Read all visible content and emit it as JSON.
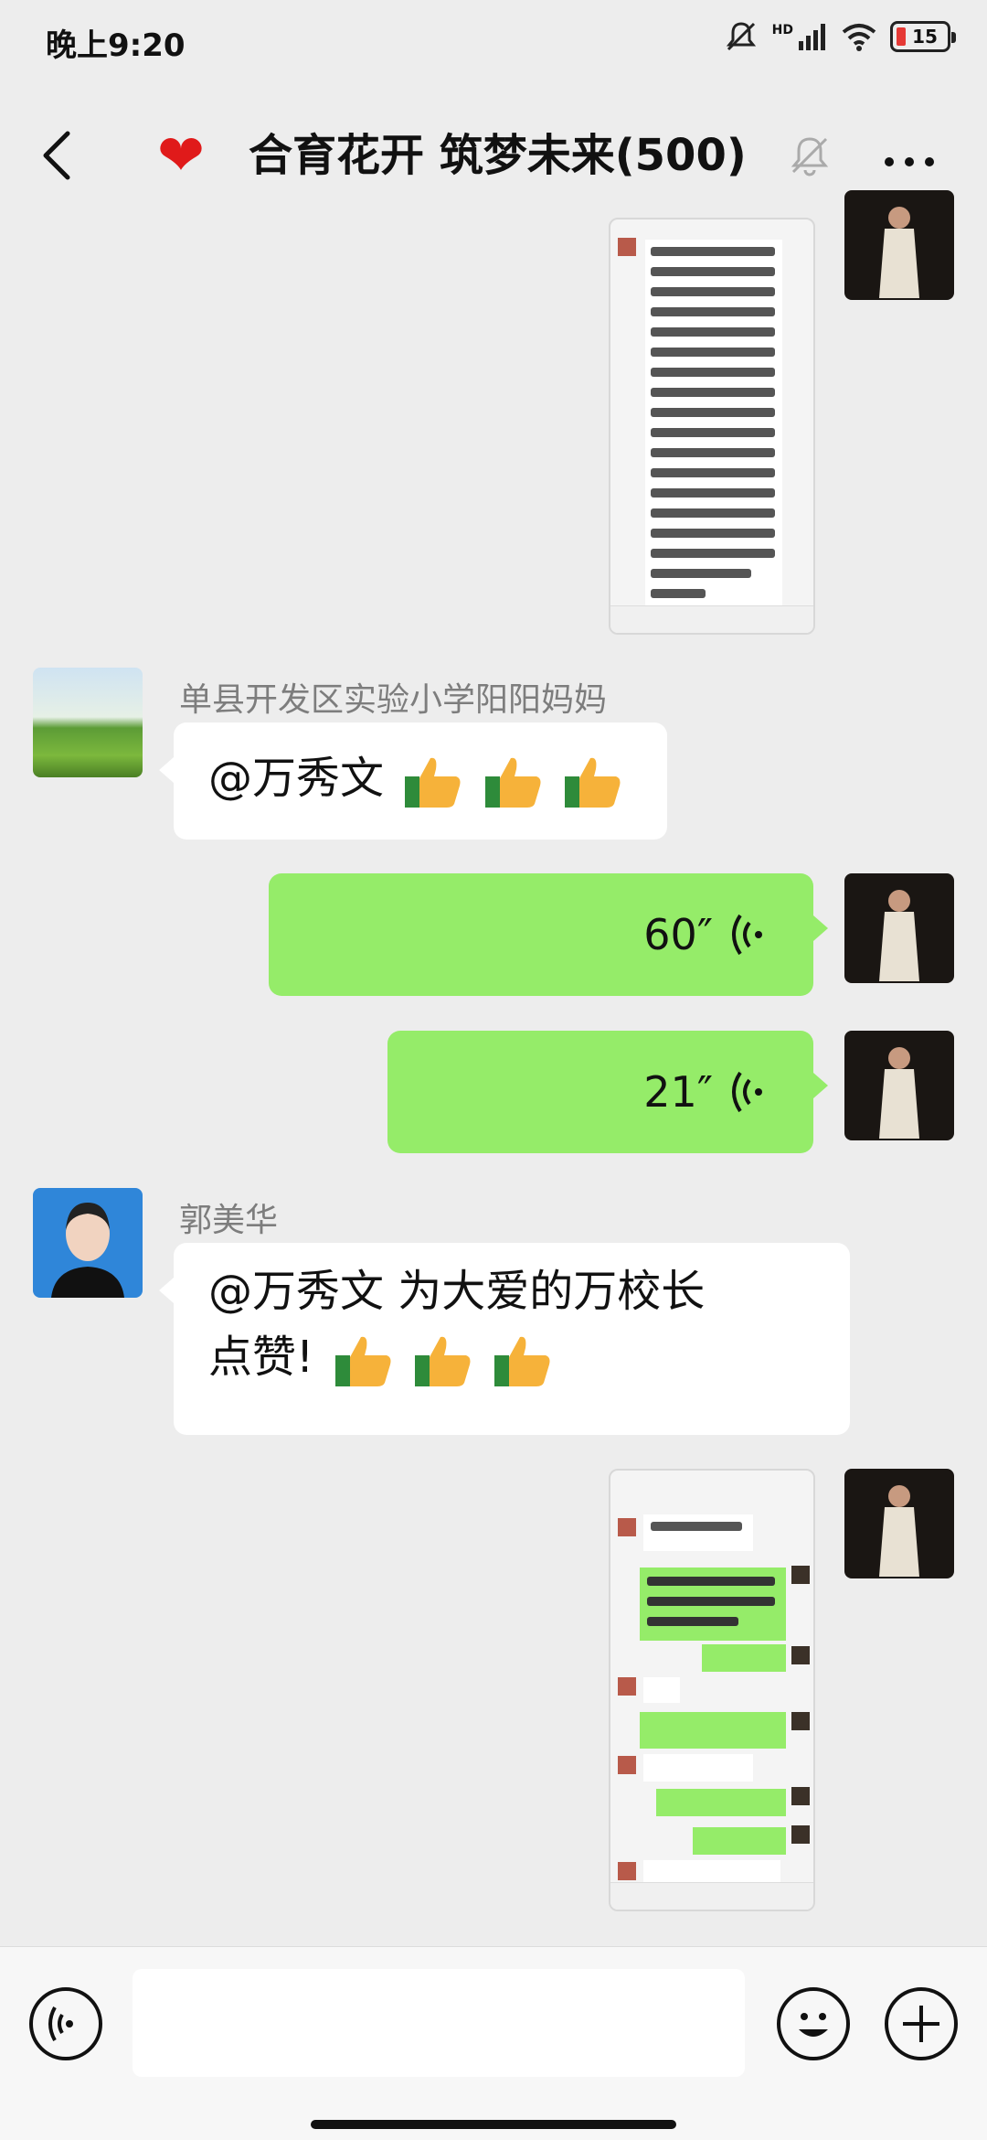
{
  "status_bar": {
    "time": "晚上9:20",
    "battery": "15",
    "network_label": "HD"
  },
  "header": {
    "title": "合育花开 筑梦未来(500)",
    "heart": "❤"
  },
  "messages": {
    "m1": {
      "type": "image",
      "from": "me"
    },
    "m2": {
      "type": "text",
      "sender": "单县开发区实验小学阳阳妈妈",
      "mention": "@万秀文",
      "text": ""
    },
    "m3": {
      "type": "voice",
      "from": "me",
      "duration": "60″"
    },
    "m4": {
      "type": "voice",
      "from": "me",
      "duration": "21″"
    },
    "m5": {
      "type": "text",
      "sender": "郭美华",
      "line1": "@万秀文  为大爱的万校长",
      "line2": "点赞!"
    },
    "m6": {
      "type": "image",
      "from": "me"
    }
  },
  "icons": [
    "back-arrow-icon",
    "heart-icon",
    "mute-bell-icon",
    "more-icon",
    "voice-mode-icon",
    "emoji-icon",
    "plus-icon",
    "thumbs-up-icon",
    "voice-wave-icon"
  ]
}
